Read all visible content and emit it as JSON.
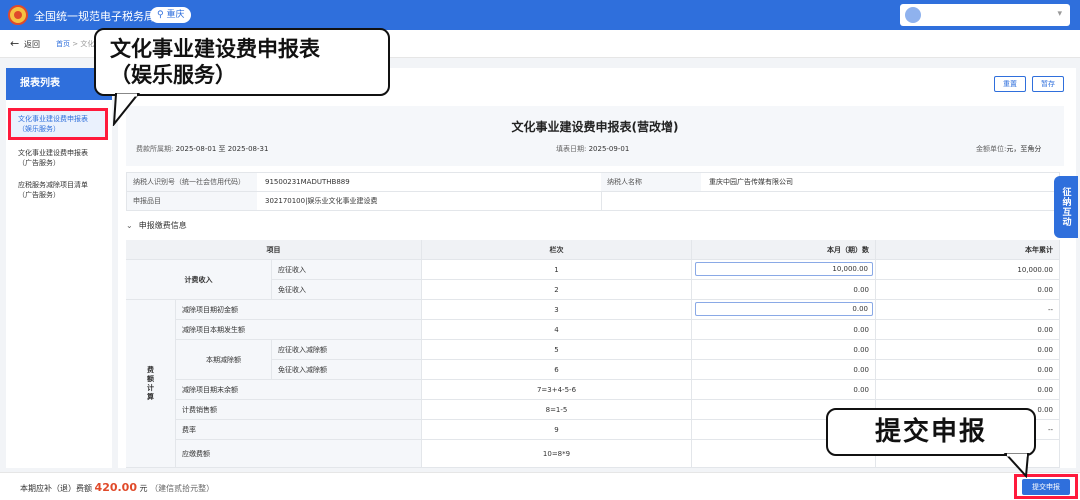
{
  "header": {
    "site_name": "全国统一规范电子税务局",
    "city": "重庆",
    "city_icon": "location-icon",
    "user_caret": "▾"
  },
  "breadcrumb": {
    "back_label": "返回",
    "home": "首页",
    "separator": " > ",
    "current": "文化"
  },
  "sidebar": {
    "title": "报表列表",
    "items": [
      {
        "line1": "文化事业建设费申报表",
        "line2": "（娱乐服务）"
      },
      {
        "line1": "文化事业建设费申报表",
        "line2": "（广告服务）"
      },
      {
        "line1": "应税服务减除项目清单",
        "line2": "（广告服务）"
      }
    ]
  },
  "toolbar": {
    "reset_label": "重置",
    "save_label": "暂存"
  },
  "form": {
    "title": "文化事业建设费申报表(营改增)",
    "period_label": "费款所属期:",
    "period_value": "2025-08-01 至 2025-08-31",
    "fill_date_label": "填表日期:",
    "fill_date_value": "2025-09-01",
    "unit_label": "金额单位:",
    "unit_value": "元，至角分",
    "taxpayer_id_label": "纳税人识别号（统一社会信用代码）",
    "taxpayer_id_value": "91500231MADUTHB889",
    "taxpayer_name_label": "纳税人名称",
    "taxpayer_name_value": "重庆中园广告传媒有限公司",
    "item_label": "申报品目",
    "item_value": "302170100|娱乐业文化事业建设费"
  },
  "section": {
    "title": "申报缴费信息",
    "chevron": "⌄"
  },
  "table": {
    "headers": {
      "item": "项目",
      "col": "栏次",
      "month": "本月（期）数",
      "year": "本年累计"
    },
    "group1": "计费收入",
    "group2": "费额计算",
    "sub_deduct": "本期减除额",
    "rows": [
      {
        "label": "应征收入",
        "col": "1",
        "month": "10,000.00",
        "year": "10,000.00"
      },
      {
        "label": "免征收入",
        "col": "2",
        "month": "0.00",
        "year": "0.00"
      },
      {
        "label": "减除项目期初金额",
        "col": "3",
        "month": "0.00",
        "year": "--"
      },
      {
        "label": "减除项目本期发生额",
        "col": "4",
        "month": "0.00",
        "year": "0.00"
      },
      {
        "label": "应征收入减除额",
        "col": "5",
        "month": "0.00",
        "year": "0.00"
      },
      {
        "label": "免征收入减除额",
        "col": "6",
        "month": "0.00",
        "year": "0.00"
      },
      {
        "label": "减除项目期末余额",
        "col": "7=3+4-5-6",
        "month": "0.00",
        "year": "0.00"
      },
      {
        "label": "计费销售额",
        "col": "8=1-5",
        "month": "",
        "year": "0.00"
      },
      {
        "label": "费率",
        "col": "9",
        "month": "",
        "year": "--"
      },
      {
        "label": "应缴费额",
        "col": "10=8*9",
        "month": "",
        "year": ""
      }
    ]
  },
  "float_tab": "征纳互动",
  "footer": {
    "due_label": "本期应补（退）费额",
    "due_amount": "420.00",
    "due_unit": "元",
    "due_note": "（建信贰拾元整）",
    "submit_label": "提交申报"
  },
  "callouts": {
    "top_line1": "文化事业建设费申报表",
    "top_line2": "（娱乐服务）",
    "bottom": "提交申报"
  },
  "colors": {
    "brand": "#2f6fdc",
    "highlight": "#ff1a3c",
    "amount": "#e04a2a"
  }
}
